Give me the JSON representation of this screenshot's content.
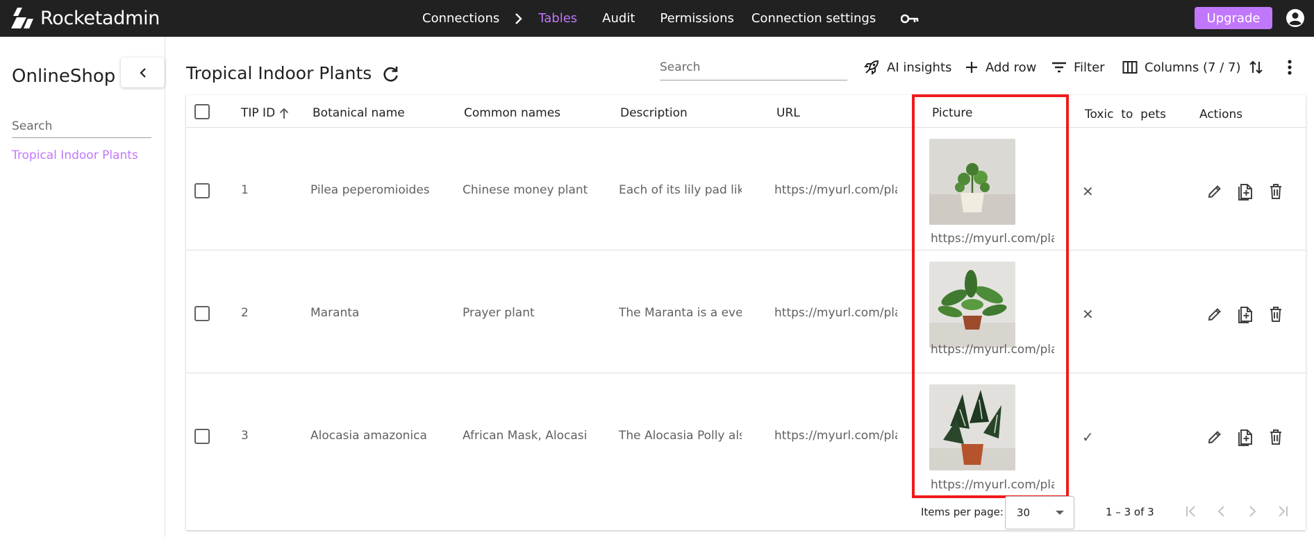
{
  "app": {
    "brand": "Rocketadmin"
  },
  "nav": {
    "connections": "Connections",
    "tables": "Tables",
    "audit": "Audit",
    "permissions": "Permissions",
    "connection_settings": "Connection settings"
  },
  "upgrade_label": "Upgrade",
  "sidebar": {
    "title": "OnlineShop",
    "search_placeholder": "Search",
    "items": [
      {
        "label": "Tropical Indoor Plants"
      }
    ]
  },
  "toolbar": {
    "title": "Tropical Indoor Plants",
    "search_placeholder": "Search",
    "ai_insights": "AI insights",
    "add_row": "Add row",
    "filter": "Filter",
    "columns": "Columns (7 / 7)"
  },
  "table": {
    "headers": {
      "tip_id": "TIP ID",
      "botanical": "Botanical name",
      "common": "Common names",
      "description": "Description",
      "url": "URL",
      "picture": "Picture",
      "toxic": "Toxic  to  pets",
      "actions": "Actions"
    },
    "sort": {
      "column": "TIP ID",
      "direction": "ascending"
    },
    "rows": [
      {
        "id": "1",
        "botanical": "Pilea peperomioides",
        "common": "Chinese money plant",
        "description": "Each of its lily pad like",
        "url": "https://myurl.com/pla",
        "picture_url": "https://myurl.com/pla",
        "toxic": "✕"
      },
      {
        "id": "2",
        "botanical": "Maranta",
        "common": "Prayer plant",
        "description": "The Maranta is a ever",
        "url": "https://myurl.com/pla",
        "picture_url": "https://myurl.com/pla",
        "toxic": "✕"
      },
      {
        "id": "3",
        "botanical": "Alocasia amazonica",
        "common": "African Mask, Alocasi",
        "description": "The Alocasia Polly als",
        "url": "https://myurl.com/pla",
        "picture_url": "https://myurl.com/pla",
        "toxic": "✓"
      }
    ]
  },
  "paginator": {
    "items_per_page_label": "Items per page:",
    "items_per_page": "30",
    "range": "1 – 3 of 3"
  },
  "colors": {
    "topbar": "#212121",
    "accent": "#c177fc",
    "highlight": "#ef1b1b"
  }
}
